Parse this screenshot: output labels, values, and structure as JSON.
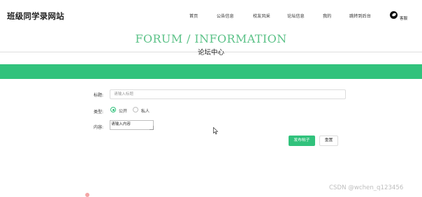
{
  "header": {
    "site_title": "班级同学录网站",
    "nav": [
      "首页",
      "公告信息",
      "校友风采",
      "论坛信息",
      "我的",
      "跳转到后台"
    ],
    "user_label": "客服"
  },
  "banner": {
    "title_en": "FORUM / INFORMATION",
    "title_zh": "论坛中心"
  },
  "form": {
    "title_label": "标题:",
    "title_placeholder": "请输入标题",
    "type_label": "类型:",
    "type_options": [
      "公开",
      "私人"
    ],
    "type_selected": "公开",
    "content_label": "内容:",
    "content_placeholder": "请输入内容",
    "submit_label": "发布帖子",
    "reset_label": "重置"
  },
  "watermark": "CSDN @wchen_q123456",
  "colors": {
    "accent": "#31c27c",
    "banner_title": "#5cc288"
  }
}
